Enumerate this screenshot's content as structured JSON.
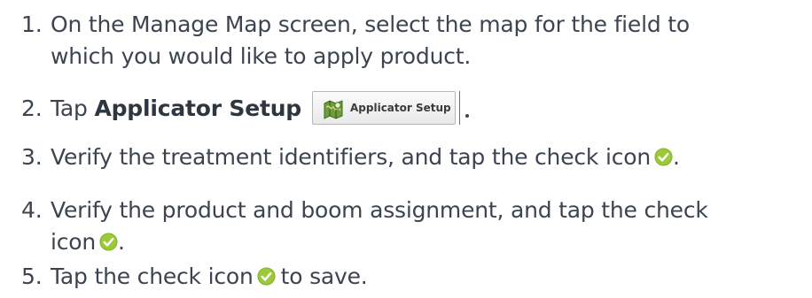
{
  "steps": [
    {
      "number": "1.",
      "line1": "On the Manage Map screen, select the map for the field to",
      "line2": "which you would like to apply product."
    },
    {
      "number": "2.",
      "prefix": "Tap ",
      "bold": "Applicator Setup",
      "button_label": "Applicator Setup",
      "button_icon": "map-icon"
    },
    {
      "number": "3.",
      "text": "Verify the treatment identifiers, and tap the check icon",
      "icon": "check-icon",
      "suffix": "."
    },
    {
      "number": "4.",
      "line1": "Verify the product and boom assignment, and tap the check",
      "line2": "icon",
      "icon": "check-icon",
      "suffix": "."
    },
    {
      "number": "5.",
      "text": "Tap the check icon",
      "icon": "check-icon",
      "suffix": "to save."
    }
  ],
  "colors": {
    "text": "#3b4450",
    "check_fill": "#9bc93a",
    "check_mark": "#ffffff",
    "button_border": "#b7b7b7"
  }
}
